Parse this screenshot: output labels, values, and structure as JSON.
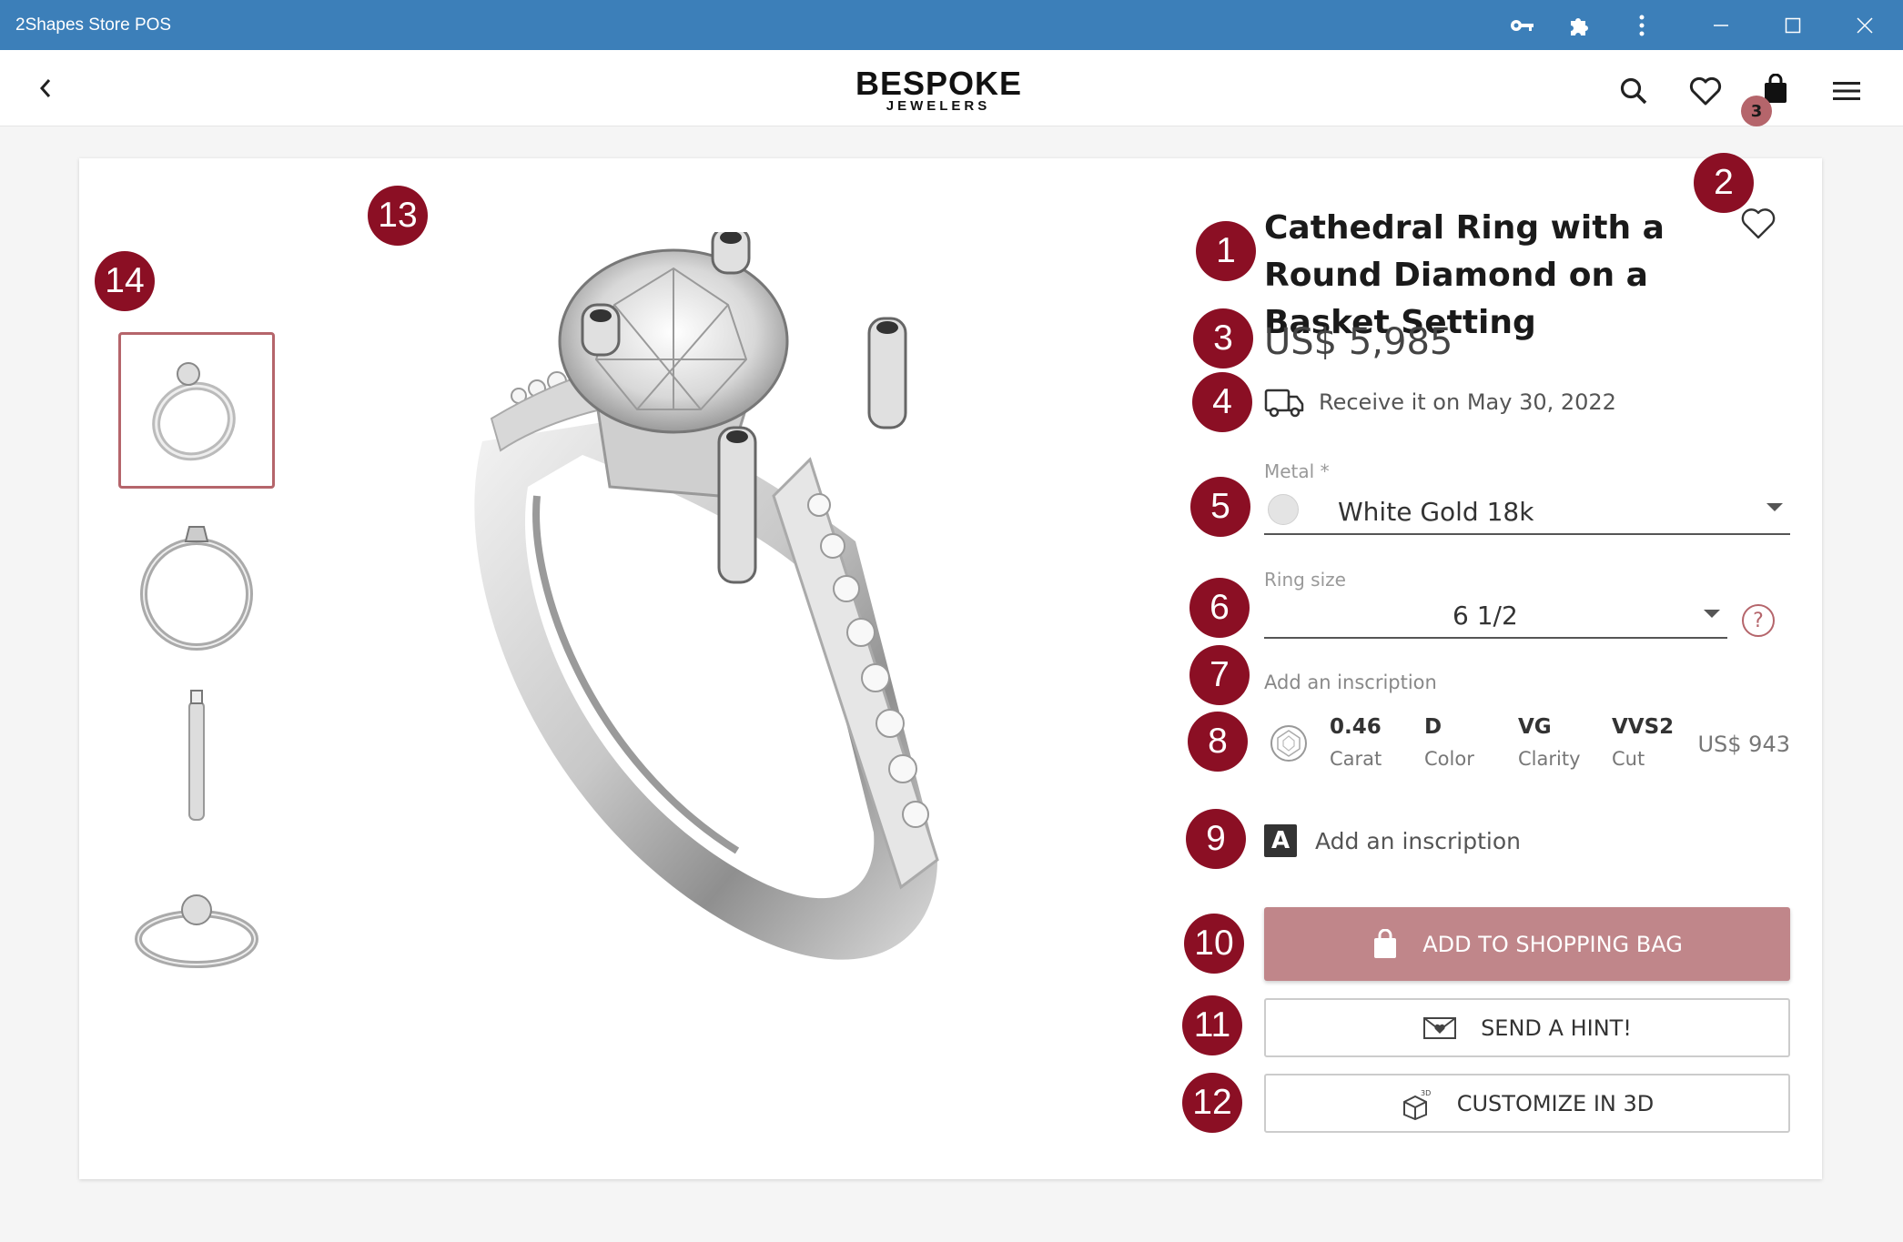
{
  "window": {
    "title": "2Shapes Store POS",
    "icons": [
      "key-icon",
      "puzzle-icon",
      "more-vertical-icon",
      "minimize-icon",
      "maximize-icon",
      "close-icon"
    ]
  },
  "header": {
    "logo_line1": "BESPOKE",
    "logo_line2": "JEWELERS",
    "bag_count": "3"
  },
  "gallery": {
    "thumbnails": [
      "ring-angle-view",
      "ring-front-view",
      "ring-side-view",
      "ring-top-view"
    ],
    "active_index": 0
  },
  "product": {
    "title": "Cathedral Ring with a Round Diamond on a Basket Setting",
    "price": "US$ 5,985",
    "delivery": "Receive it on May 30, 2022",
    "metal_label": "Metal *",
    "metal_value": "White Gold 18k",
    "ring_size_label": "Ring size",
    "ring_size_value": "6 1/2",
    "inscription_hint": "Add an inscription",
    "diamond": {
      "carat_value": "0.46",
      "carat_label": "Carat",
      "color_value": "D",
      "color_label": "Color",
      "clarity_value": "VG",
      "clarity_label": "Clarity",
      "cut_value": "VVS2",
      "cut_label": "Cut",
      "price": "US$ 943"
    },
    "inscription_label": "Add an inscription",
    "inscription_icon_letter": "A"
  },
  "actions": {
    "add_to_bag": "ADD TO SHOPPING BAG",
    "send_hint": "SEND A HINT!",
    "customize": "CUSTOMIZE IN 3D"
  },
  "markers": [
    "1",
    "2",
    "3",
    "4",
    "5",
    "6",
    "7",
    "8",
    "9",
    "10",
    "11",
    "12",
    "13",
    "14"
  ],
  "colors": {
    "titlebar": "#3c7fb9",
    "marker": "#8b0f24",
    "accent": "#b5656b",
    "primary_button": "#c0868a"
  }
}
